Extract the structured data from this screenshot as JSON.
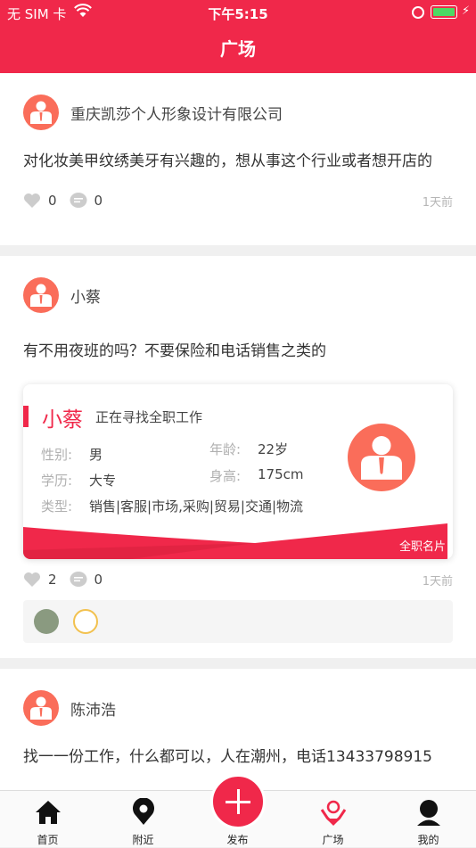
{
  "status": {
    "carrier": "无 SIM 卡",
    "time": "下午5:15"
  },
  "header": {
    "title": "广场"
  },
  "posts": [
    {
      "author": "重庆凯莎个人形象设计有限公司",
      "text": "对化妆美甲纹绣美牙有兴趣的，想从事这个行业或者想开店的",
      "likes": "0",
      "comments": "0",
      "time": "1天前"
    },
    {
      "author": "小蔡",
      "text": "有不用夜班的吗？不要保险和电话销售之类的",
      "likes": "2",
      "comments": "0",
      "time": "1天前",
      "card": {
        "name": "小蔡",
        "seeking": "正在寻找全职工作",
        "gender_label": "性别:",
        "gender": "男",
        "age_label": "年龄:",
        "age": "22岁",
        "edu_label": "学历:",
        "edu": "大专",
        "height_label": "身高:",
        "height": "175cm",
        "type_label": "类型:",
        "type": "销售|客服|市场,采购|贸易|交通|物流",
        "tag": "全职名片"
      }
    },
    {
      "author": "陈沛浩",
      "text": "找一一份工作，什么都可以，人在潮州，电话13433798915"
    }
  ],
  "tabs": [
    {
      "label": "首页",
      "icon": "home-icon"
    },
    {
      "label": "附近",
      "icon": "location-pin-icon"
    },
    {
      "label": "发布",
      "icon": "plus-icon"
    },
    {
      "label": "广场",
      "icon": "square-icon"
    },
    {
      "label": "我的",
      "icon": "profile-icon"
    }
  ],
  "colors": {
    "brand": "#f0284a",
    "avatar": "#fa6d5a"
  }
}
